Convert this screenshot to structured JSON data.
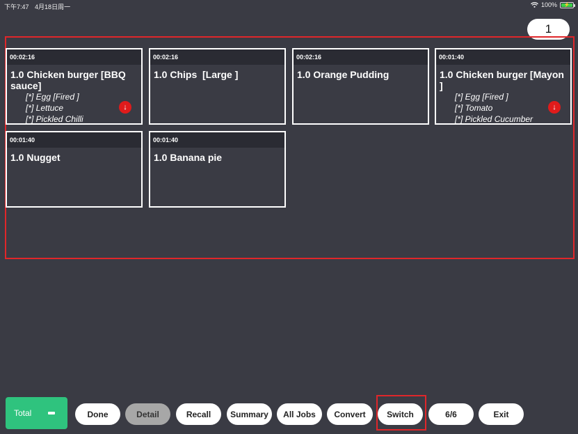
{
  "status_bar": {
    "time": "下午7:47",
    "date": "4月18日周一",
    "battery_percent": "100%"
  },
  "page_indicator": "1",
  "orders": [
    {
      "timer": "00:02:16",
      "title": "1.0 Chicken burger [BBQ sauce]",
      "modifiers": [
        "[*] Egg [Fired ]",
        "[*] Lettuce",
        "[*] Pickled Chilli"
      ],
      "scroll_icon": "↓"
    },
    {
      "timer": "00:02:16",
      "title": "1.0 Chips  [Large ]",
      "modifiers": []
    },
    {
      "timer": "00:02:16",
      "title": "1.0 Orange Pudding",
      "modifiers": []
    },
    {
      "timer": "00:01:40",
      "title": "1.0 Chicken burger [Mayon ]",
      "modifiers": [
        "[*] Egg [Fired ]",
        "[*] Tomato",
        "[*] Pickled Cucumber"
      ],
      "scroll_icon": "↓"
    },
    {
      "timer": "00:01:40",
      "title": "1.0 Nugget",
      "modifiers": []
    },
    {
      "timer": "00:01:40",
      "title": "1.0 Banana pie",
      "modifiers": []
    }
  ],
  "toolbar": {
    "total_label": "Total",
    "done": "Done",
    "detail": "Detail",
    "recall": "Recall",
    "summary": "Summary",
    "all_jobs": "All Jobs",
    "convert": "Convert",
    "switch": "Switch",
    "pages": "6/6",
    "exit": "Exit"
  },
  "colors": {
    "background": "#3a3b44",
    "card_header": "#2a2b33",
    "total_green": "#2fc37e",
    "highlight_red": "#e0262a",
    "active_button": "#a7a7a7"
  }
}
